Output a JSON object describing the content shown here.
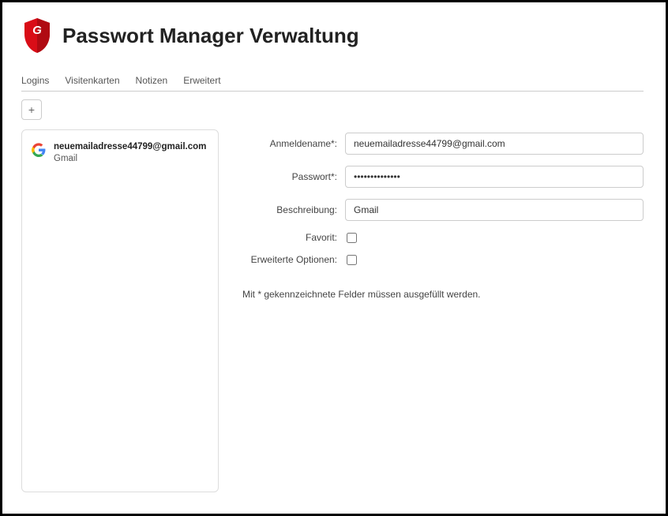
{
  "header": {
    "title": "Passwort Manager Verwaltung"
  },
  "tabs": [
    {
      "label": "Logins"
    },
    {
      "label": "Visitenkarten"
    },
    {
      "label": "Notizen"
    },
    {
      "label": "Erweitert"
    }
  ],
  "add_button": "+",
  "list": {
    "items": [
      {
        "title": "neuemailadresse44799@gmail.com",
        "subtitle": "Gmail"
      }
    ]
  },
  "form": {
    "login_name_label": "Anmeldename*:",
    "login_name_value": "neuemailadresse44799@gmail.com",
    "password_label": "Passwort*:",
    "password_value": "••••••••••••••",
    "description_label": "Beschreibung:",
    "description_value": "Gmail",
    "favorite_label": "Favorit:",
    "advanced_label": "Erweiterte Optionen:",
    "required_note": "Mit * gekennzeichnete Felder müssen ausgefüllt werden."
  }
}
